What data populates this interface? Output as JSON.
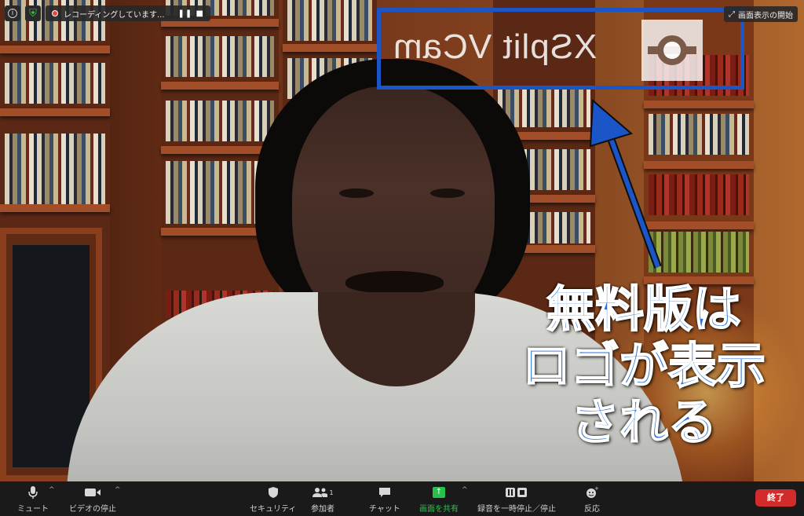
{
  "top_bar": {
    "recording_text": "レコーディングしています...",
    "recording_controls": "❚❚  ■",
    "view_button": "画面表示の開始",
    "view_icon": "expand-icon"
  },
  "overlay": {
    "logo_text": "XSplit VCam",
    "caption_lines": [
      "無料版は",
      "ロゴが表示",
      "される"
    ],
    "accent_color": "#1a56c8"
  },
  "toolbar": {
    "mute_label": "ミュート",
    "video_label": "ビデオの停止",
    "security_label": "セキュリティ",
    "participants_label": "参加者",
    "participants_count": "1",
    "chat_label": "チャット",
    "share_label": "画面を共有",
    "record_label": "録音を一時停止／停止",
    "reactions_label": "反応",
    "end_label": "終了",
    "share_color": "#27c24c",
    "end_color": "#d22b2b"
  }
}
